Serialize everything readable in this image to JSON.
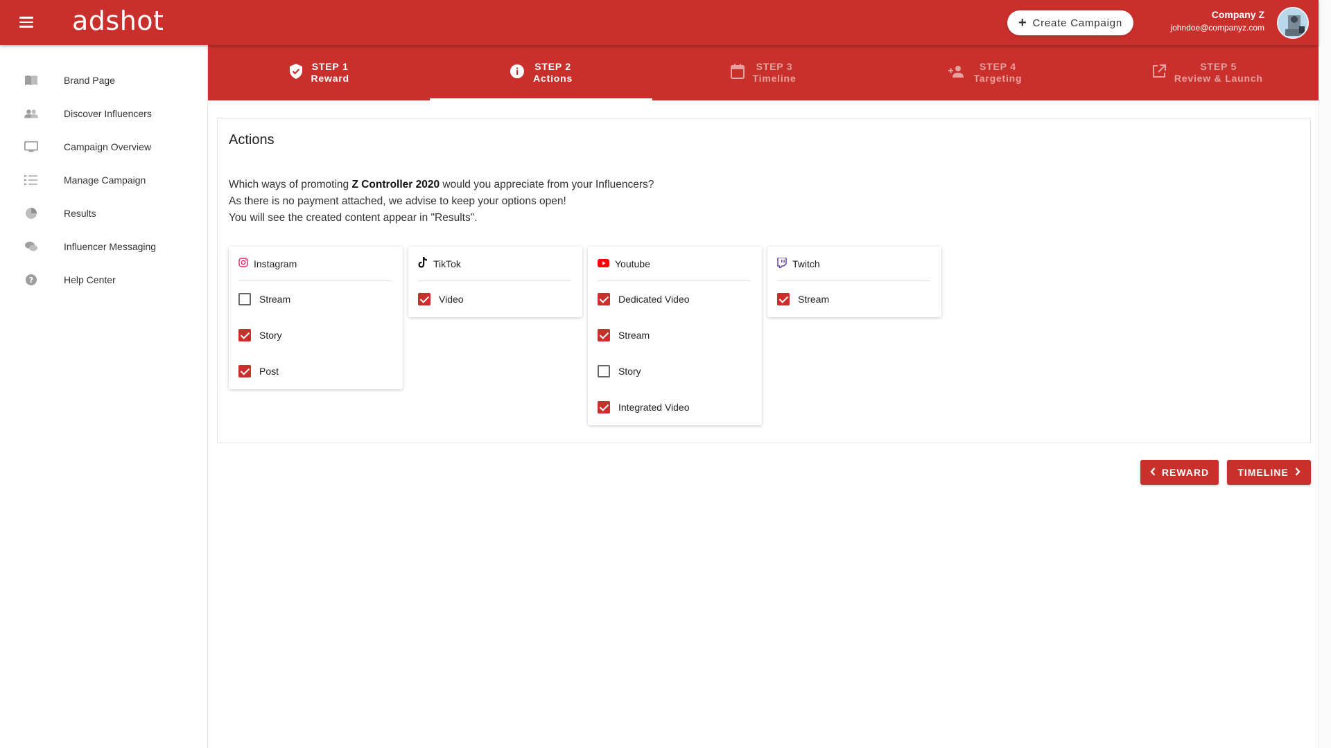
{
  "app": {
    "name": "adshot",
    "create_campaign": "Create Campaign",
    "company": "Company Z",
    "email": "johndoe@companyz.com"
  },
  "sidebar": {
    "items": [
      {
        "label": "Brand Page",
        "icon": "book-icon"
      },
      {
        "label": "Discover Influencers",
        "icon": "people-icon"
      },
      {
        "label": "Campaign Overview",
        "icon": "monitor-icon"
      },
      {
        "label": "Manage Campaign",
        "icon": "checklist-icon"
      },
      {
        "label": "Results",
        "icon": "pie-chart-icon"
      },
      {
        "label": "Influencer Messaging",
        "icon": "chat-icon"
      },
      {
        "label": "Help Center",
        "icon": "help-icon"
      }
    ]
  },
  "stepper": {
    "steps": [
      {
        "step": "STEP 1",
        "name": "Reward",
        "state": "done"
      },
      {
        "step": "STEP 2",
        "name": "Actions",
        "state": "active"
      },
      {
        "step": "STEP 3",
        "name": "Timeline",
        "state": "pending"
      },
      {
        "step": "STEP 4",
        "name": "Targeting",
        "state": "pending"
      },
      {
        "step": "STEP 5",
        "name": "Review & Launch",
        "state": "pending"
      }
    ]
  },
  "actions": {
    "title": "Actions",
    "desc_prefix": "Which ways of promoting ",
    "product": "Z Controller 2020",
    "desc_suffix": " would you appreciate from your Influencers?",
    "line2": "As there is no payment attached, we advise to keep your options open!",
    "line3": "You will see the created content appear in \"Results\".",
    "platforms": [
      {
        "name": "Instagram",
        "icon": "instagram-icon",
        "options": [
          {
            "label": "Stream",
            "checked": false
          },
          {
            "label": "Story",
            "checked": true
          },
          {
            "label": "Post",
            "checked": true
          }
        ]
      },
      {
        "name": "TikTok",
        "icon": "tiktok-icon",
        "options": [
          {
            "label": "Video",
            "checked": true
          }
        ]
      },
      {
        "name": "Youtube",
        "icon": "youtube-icon",
        "options": [
          {
            "label": "Dedicated Video",
            "checked": true
          },
          {
            "label": "Stream",
            "checked": true
          },
          {
            "label": "Story",
            "checked": false
          },
          {
            "label": "Integrated Video",
            "checked": true
          }
        ]
      },
      {
        "name": "Twitch",
        "icon": "twitch-icon",
        "options": [
          {
            "label": "Stream",
            "checked": true
          }
        ]
      }
    ]
  },
  "nav": {
    "back": "REWARD",
    "next": "TIMELINE"
  },
  "colors": {
    "primary": "#c9302c"
  }
}
